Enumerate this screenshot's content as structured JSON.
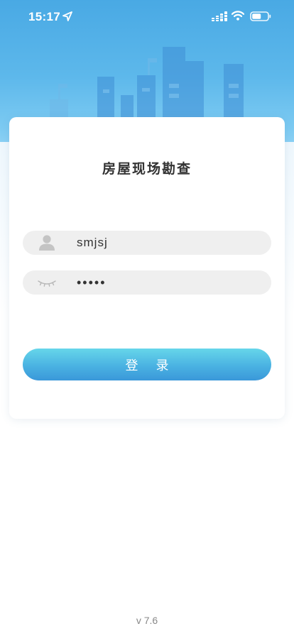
{
  "status_bar": {
    "time": "15:17",
    "icons": [
      "location-arrow-icon",
      "signal-icon",
      "wifi-icon",
      "battery-icon"
    ]
  },
  "login": {
    "title": "房屋现场勘查",
    "username": {
      "value": "smjsj",
      "icon": "user-icon"
    },
    "password": {
      "value": "•••••",
      "icon": "eye-closed-icon"
    },
    "submit_label": "登 录"
  },
  "footer": {
    "version": "v 7.6"
  },
  "colors": {
    "header_top": "#49a9e4",
    "button_top": "#66d6ea",
    "button_bottom": "#3a98d9",
    "field_bg": "#efefef",
    "title_text": "#333333"
  }
}
